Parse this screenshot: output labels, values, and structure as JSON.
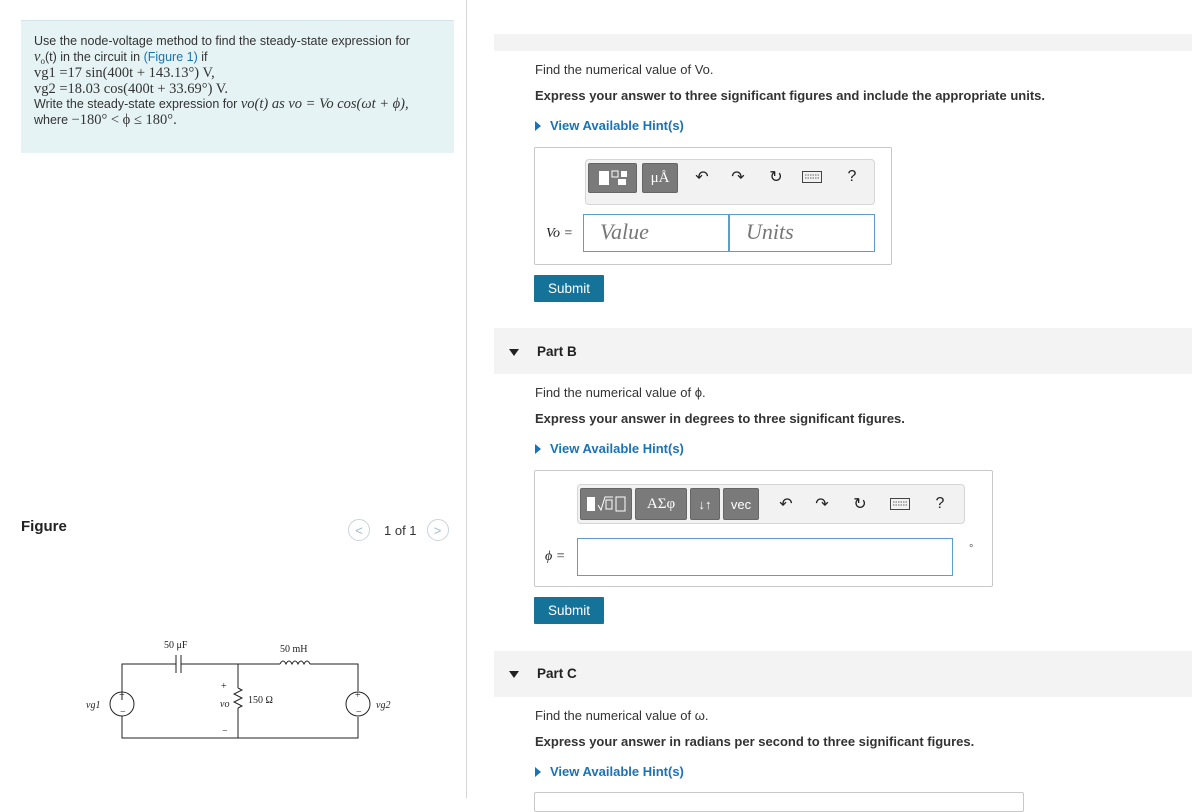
{
  "problem": {
    "line1": "Use the node-voltage method to find the steady-state expression for",
    "line2_math": "v",
    "line2_rest": "(t) in the circuit in ",
    "figure_link": "(Figure 1)",
    "line2_end": " if",
    "vg1": "vg1 =17 sin(400t + 143.13°) V,",
    "vg2": "vg2 =18.03 cos(400t + 33.69°) V.",
    "line5": "Write the steady-state expression for",
    "line5_math": "vo(t) as vo = Vo cos(ωt + ϕ),",
    "line6": "where",
    "line6_math": "−180° < ϕ ≤ 180°."
  },
  "figure": {
    "label": "Figure",
    "pager": "1 of 1",
    "prev_glyph": "<",
    "next_glyph": ">",
    "circuit": {
      "cap": "50 μF",
      "ind": "50 mH",
      "res": "150 Ω",
      "src1": "vg1",
      "src2": "vg2",
      "vo": "vo",
      "plus": "+",
      "minus": "−"
    }
  },
  "partA": {
    "prompt": "Find the numerical value of Vo.",
    "instruction": "Express your answer to three significant figures and include the appropriate units.",
    "hint": "View Available Hint(s)",
    "toolbar": {
      "units_btn": "μÅ",
      "help": "?"
    },
    "var_label": "Vo =",
    "value_placeholder": "Value",
    "units_placeholder": "Units",
    "submit": "Submit"
  },
  "partB": {
    "title": "Part B",
    "prompt": "Find the numerical value of ϕ.",
    "instruction": "Express your answer in degrees to three significant figures.",
    "hint": "View Available Hint(s)",
    "toolbar": {
      "greek": "ΑΣφ",
      "arrows": "↓↑",
      "vec": "vec",
      "help": "?"
    },
    "var_label": "ϕ =",
    "unit_suffix": "°",
    "submit": "Submit"
  },
  "partC": {
    "title": "Part C",
    "prompt": "Find the numerical value of ω.",
    "instruction": "Express your answer in radians per second to three significant figures.",
    "hint": "View Available Hint(s)"
  },
  "colors": {
    "accent": "#15739a",
    "link": "#1a73b5",
    "problem_bg": "#e6f3f5"
  }
}
